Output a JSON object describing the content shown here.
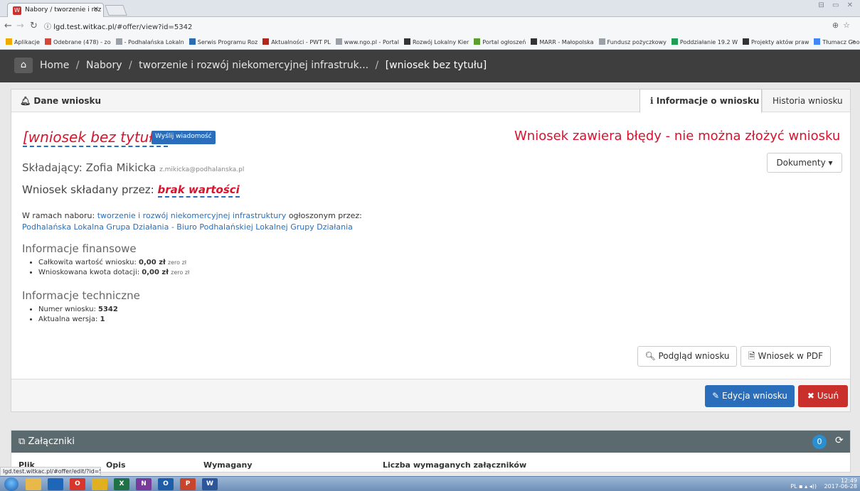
{
  "browser": {
    "tab_title": "Nabory / tworzenie i roz",
    "tab_favicon": "W",
    "url_host": "lgd.test.witkac.pl",
    "url_path": "/#offer/view?id=5342",
    "window_controls": "⊟ ▭ ✕",
    "bookmarks": [
      {
        "label": "Aplikacje",
        "color": "#f2a900"
      },
      {
        "label": "Odebrane (478) - zo",
        "color": "#d44638"
      },
      {
        "label": "- Podhalańska Lokaln",
        "color": "#9aa0a6"
      },
      {
        "label": "Serwis Programu Roz",
        "color": "#2b6cb0"
      },
      {
        "label": "Aktualności - PWT PL",
        "color": "#b3261e"
      },
      {
        "label": "www.ngo.pl - Portal",
        "color": "#9aa0a6"
      },
      {
        "label": "Rozwój Lokalny Kier",
        "color": "#333333"
      },
      {
        "label": "Portal ogłoszeń",
        "color": "#5a9e2f"
      },
      {
        "label": "MARR - Małopolska",
        "color": "#333333"
      },
      {
        "label": "Fundusz pożyczkowy",
        "color": "#9aa0a6"
      },
      {
        "label": "Poddziałanie 19.2 W",
        "color": "#1f9d55"
      },
      {
        "label": "Projekty aktów praw",
        "color": "#333333"
      },
      {
        "label": "Tłumacz Google",
        "color": "#4285f4"
      }
    ],
    "bookmarks_more": "»",
    "status_url": "lgd.test.witkac.pl/#offer/edit/?id=5342"
  },
  "header": {
    "crumbs": [
      "Home",
      "Nabory",
      "tworzenie i rozwój niekomercyjnej infrastruk...",
      "[wniosek bez tytułu]"
    ],
    "separator": "/"
  },
  "panel": {
    "title": "Dane wniosku",
    "tab_info": "Informacje o wniosku",
    "tab_history": "Historia wniosku",
    "app_title": "[wniosek bez tytułu]",
    "send_msg": "Wyślij wiadomość",
    "error": "Wniosek zawiera błędy - nie można złożyć wniosku",
    "docs": "Dokumenty",
    "applicant_label": "Składający: Zofia Mikicka",
    "applicant_email": "z.mikicka@podhalanska.pl",
    "submitted_label": "Wniosek składany przez:",
    "submitted_value": "brak wartości",
    "nabor_prefix": "W ramach naboru:",
    "nabor_link": "tworzenie i rozwój niekomercyjnej infrastruktury",
    "nabor_suffix": "ogłoszonym przez:",
    "nabor_org": "Podhalańska Lokalna Grupa Działania - Biuro Podhalańskiej Lokalnej Grupy Działania",
    "fin_title": "Informacje finansowe",
    "fin_total_label": "Całkowita wartość wniosku:",
    "fin_total_value": "0,00 zł",
    "fin_total_words": "zero zł",
    "fin_grant_label": "Wnioskowana kwota dotacji:",
    "fin_grant_value": "0,00 zł",
    "fin_grant_words": "zero zł",
    "tech_title": "Informacje techniczne",
    "tech_num_label": "Numer wniosku:",
    "tech_num_value": "5342",
    "tech_ver_label": "Aktualna wersja:",
    "tech_ver_value": "1",
    "btn_preview": "Podgląd wniosku",
    "btn_pdf": "Wniosek w PDF",
    "btn_edit": "Edycja wniosku",
    "btn_delete": "Usuń"
  },
  "attachments": {
    "title": "Załączniki",
    "count": "0",
    "columns": [
      "Plik",
      "Opis",
      "Wymagany",
      "Liczba wymaganych załączników"
    ]
  },
  "taskbar": {
    "apps": [
      {
        "icon": "explorer-icon",
        "color": "#e8b84a",
        "glyph": ""
      },
      {
        "icon": "thunderbird-icon",
        "color": "#1e66b8",
        "glyph": ""
      },
      {
        "icon": "opera-icon",
        "color": "#d8362a",
        "glyph": "O"
      },
      {
        "icon": "chrome-icon",
        "color": "#e0b020",
        "glyph": ""
      },
      {
        "icon": "excel-icon",
        "color": "#1f7245",
        "glyph": "X"
      },
      {
        "icon": "onenote-icon",
        "color": "#7a3a9c",
        "glyph": "N"
      },
      {
        "icon": "outlook-icon",
        "color": "#1e5ea8",
        "glyph": "O"
      },
      {
        "icon": "powerpoint-icon",
        "color": "#c8442a",
        "glyph": "P"
      },
      {
        "icon": "word-icon",
        "color": "#2b579a",
        "glyph": "W"
      }
    ],
    "clock": "12:49",
    "date": "2017-06-28",
    "lang": "PL"
  }
}
